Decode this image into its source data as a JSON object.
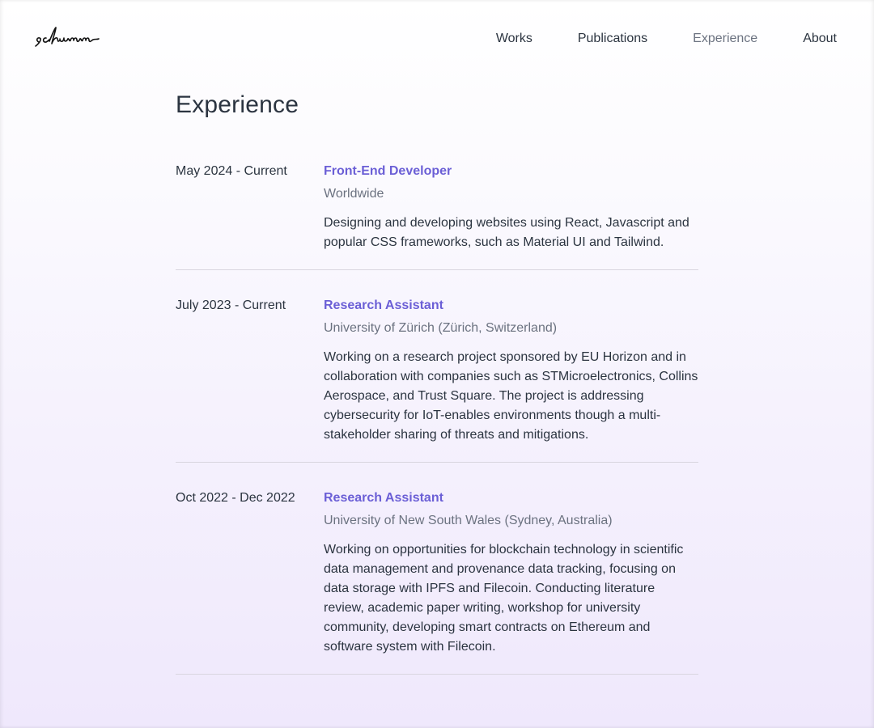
{
  "brand": {
    "logo_text": "schumm"
  },
  "nav": {
    "items": [
      {
        "label": "Works",
        "active": false
      },
      {
        "label": "Publications",
        "active": false
      },
      {
        "label": "Experience",
        "active": true
      },
      {
        "label": "About",
        "active": false
      }
    ]
  },
  "page": {
    "title": "Experience"
  },
  "experience": [
    {
      "date": "May 2024 - Current",
      "role": "Front-End Developer",
      "org": "Worldwide",
      "description": "Designing and developing websites using React, Javascript and popular CSS frameworks, such as Material UI and Tailwind."
    },
    {
      "date": "July 2023 - Current",
      "role": "Research Assistant",
      "org": "University of Zürich (Zürich, Switzerland)",
      "description": "Working on a research project sponsored by EU Horizon and in collaboration with companies such as STMicroelectronics, Collins Aerospace, and Trust Square. The project is addressing cybersecurity for IoT-enables environments though a multi-stakeholder sharing of threats and mitigations."
    },
    {
      "date": "Oct 2022 - Dec 2022",
      "role": "Research Assistant",
      "org": "University of New South Wales (Sydney, Australia)",
      "description": "Working on opportunities for blockchain technology in scientific data management and provenance data tracking, focusing on data storage with IPFS and Filecoin. Conducting literature review, academic paper writing, workshop for university community, developing smart contracts on Ethereum and software system with Filecoin."
    }
  ],
  "colors": {
    "accent": "#6b5fd6",
    "text": "#2b3440",
    "muted": "#6b7280",
    "divider": "#d9d6e0"
  }
}
